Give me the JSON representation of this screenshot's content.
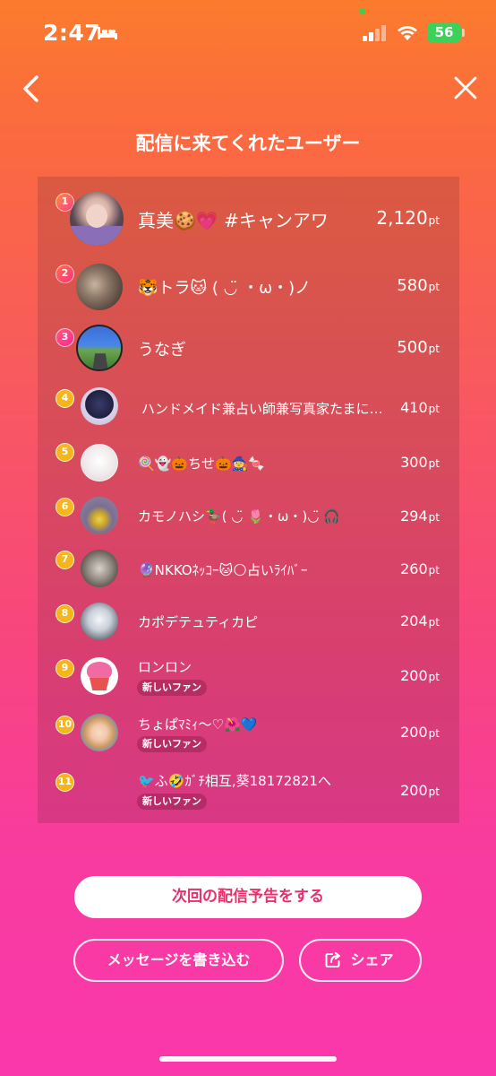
{
  "status_bar": {
    "time": "2:47",
    "battery": "56"
  },
  "header": {
    "title": "配信に来てくれたユーザー"
  },
  "users": [
    {
      "rank": "1",
      "name": "真美🍪💗 #キャンアワ",
      "points": "2,120",
      "unit": "pt",
      "badge": ""
    },
    {
      "rank": "2",
      "name": "🐯トラ🐱 ( ◡̈ ・ω・)ノ",
      "points": "580",
      "unit": "pt",
      "badge": ""
    },
    {
      "rank": "3",
      "name": "うなぎ",
      "points": "500",
      "unit": "pt",
      "badge": ""
    },
    {
      "rank": "4",
      "name": "ハンドメイド兼占い師兼写真家たまにゲーム",
      "points": "410",
      "unit": "pt",
      "badge": ""
    },
    {
      "rank": "5",
      "name": "🍭👻🎃ちせ🎃🧙🍬",
      "points": "300",
      "unit": "pt",
      "badge": ""
    },
    {
      "rank": "6",
      "name": "カモノハシ🦆( ◡̈ 🌷・ω・)◡̈ 🎧",
      "points": "294",
      "unit": "pt",
      "badge": ""
    },
    {
      "rank": "7",
      "name": "🔮NKKOﾈｯｺｰ🐱🌕占いﾗｲﾊﾞｰ",
      "points": "260",
      "unit": "pt",
      "badge": ""
    },
    {
      "rank": "8",
      "name": "カポデテュティカピ",
      "points": "204",
      "unit": "pt",
      "badge": ""
    },
    {
      "rank": "9",
      "name": "ロンロン",
      "points": "200",
      "unit": "pt",
      "badge": "新しいファン"
    },
    {
      "rank": "10",
      "name": "ちょぱﾏﾐｨ〜♡🌺💙",
      "points": "200",
      "unit": "pt",
      "badge": "新しいファン"
    },
    {
      "rank": "11",
      "name": "🐦ふ🤣ｶﾞﾁ相互,葵18172821へ",
      "points": "200",
      "unit": "pt",
      "badge": "新しいファン"
    }
  ],
  "actions": {
    "announce_label": "次回の配信予告をする",
    "message_label": "メッセージを書き込む",
    "share_label": "シェア"
  },
  "colors": {
    "accent": "#e9306c",
    "battery": "#3fd05a",
    "rank_badge": "#f6b51d"
  },
  "icons": [
    "bed-icon",
    "signal-icon",
    "wifi-icon",
    "battery-icon",
    "back-chevron-icon",
    "close-icon",
    "share-icon"
  ]
}
